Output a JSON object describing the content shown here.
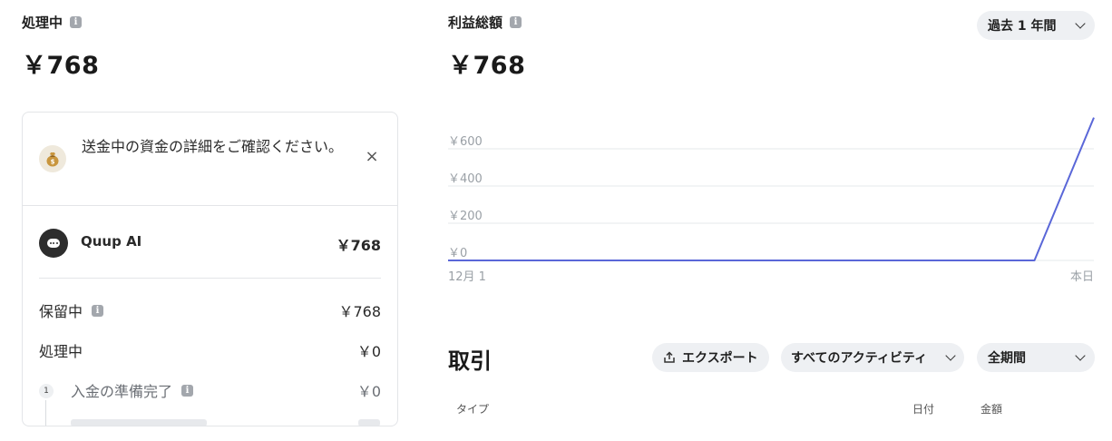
{
  "processing": {
    "label": "処理中",
    "amount": "￥768"
  },
  "profit": {
    "label": "利益総額",
    "amount": "￥768",
    "period_select": "過去 1 年間"
  },
  "notice": {
    "text": "送金中の資金の詳細をご確認ください。",
    "close_symbol": "×"
  },
  "merchant": {
    "name": "Quup AI",
    "amount": "￥768"
  },
  "breakdown": {
    "hold_label": "保留中",
    "hold_amount": "￥768",
    "processing_label": "処理中",
    "processing_amount": "￥0",
    "step1_num": "1",
    "step1_label": "入金の準備完了",
    "step1_amount": "￥0"
  },
  "chart_data": {
    "type": "line",
    "x_start_label": "12月 1",
    "x_end_label": "本日",
    "yticks": [
      "￥0",
      "￥200",
      "￥400",
      "￥600"
    ],
    "ylim": [
      0,
      768
    ],
    "series": [
      {
        "values": [
          0,
          0,
          768
        ],
        "x_frac": [
          0,
          0.908,
          1.0
        ]
      }
    ],
    "line_color": "#5a67d8",
    "grid": true
  },
  "transactions": {
    "title": "取引",
    "export_label": "エクスポート",
    "activity_select": "すべてのアクティビティ",
    "period_select": "全期間",
    "columns": {
      "type": "タイプ",
      "date": "日付",
      "amount": "金額"
    }
  }
}
